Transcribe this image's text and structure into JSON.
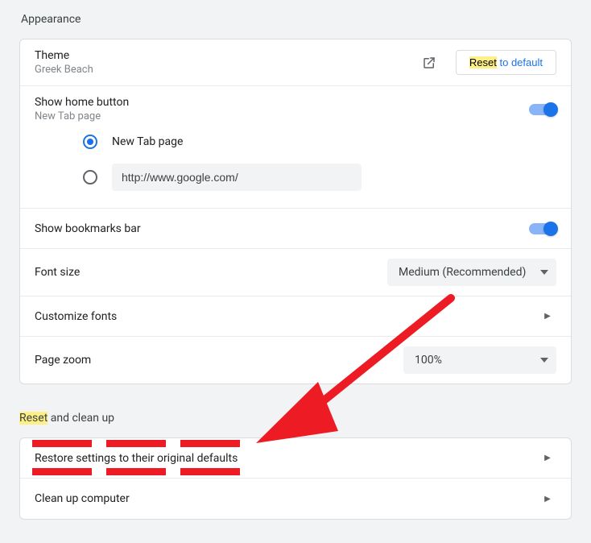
{
  "appearance": {
    "title": "Appearance",
    "theme": {
      "label": "Theme",
      "value": "Greek Beach"
    },
    "reset_button": {
      "highlight": "Reset",
      "rest": " to default"
    },
    "show_home": {
      "label": "Show home button",
      "sublabel": "New Tab page",
      "options": {
        "newtab": "New Tab page",
        "custom_url_value": "http://www.google.com/"
      }
    },
    "show_bookmarks": {
      "label": "Show bookmarks bar"
    },
    "font_size": {
      "label": "Font size",
      "value": "Medium (Recommended)"
    },
    "customize_fonts": {
      "label": "Customize fonts"
    },
    "page_zoom": {
      "label": "Page zoom",
      "value": "100%"
    }
  },
  "reset": {
    "title_hl": "Reset",
    "title_rest": " and clean up",
    "restore": "Restore settings to their original defaults",
    "cleanup": "Clean up computer"
  }
}
